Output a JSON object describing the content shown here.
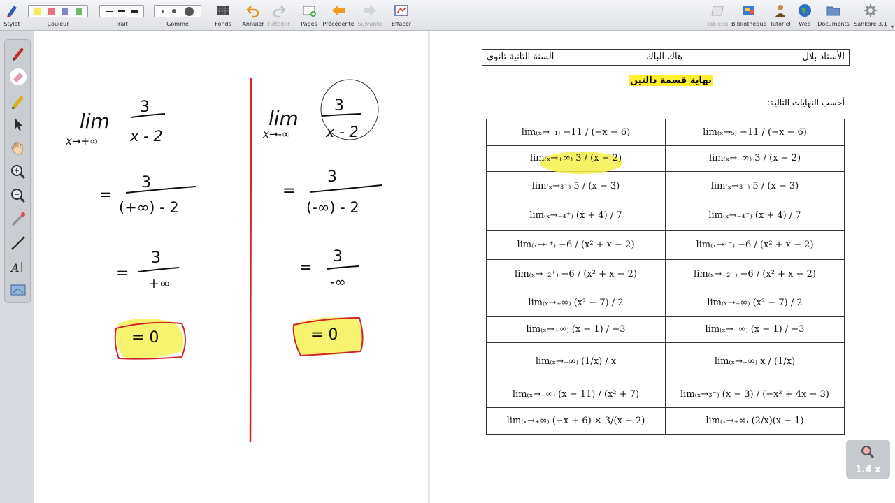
{
  "toolbar": {
    "pen": "Stylet",
    "color": "Couleur",
    "stroke": "Trait",
    "eraser": "Gomme",
    "background": "Fonds",
    "undo": "Annuler",
    "redo": "Rétablir",
    "pages": "Pages",
    "previous": "Précédente",
    "next": "Suivante",
    "clear": "Effacer",
    "board": "Tableau",
    "library": "Bibliothèque",
    "tutorial": "Tutoriel",
    "web": "Web",
    "documents": "Documents",
    "app": "Sankore 3.1"
  },
  "palette_icons": [
    "pen-icon",
    "eraser-icon",
    "marker-icon",
    "pointer-icon",
    "hand-icon",
    "zoom-in-icon",
    "zoom-out-icon",
    "laser-pointer-icon",
    "line-icon",
    "text-icon",
    "capture-icon"
  ],
  "colors": {
    "swatches": [
      "#f2ef55",
      "#e8717a",
      "#7d86c7",
      "#71b86b"
    ],
    "ink": "#111111",
    "red_line": "#d0252b",
    "highlight": "#f4f04a"
  },
  "left_page": {
    "col1": {
      "line1": {
        "lim": "lim",
        "sub": "x→+∞",
        "num": "3",
        "den": "x - 2"
      },
      "line2": {
        "eq": "=",
        "num": "3",
        "den": "(+∞) - 2"
      },
      "line3": {
        "eq": "=",
        "num": "3",
        "den": "+∞"
      },
      "result": "= 0"
    },
    "col2": {
      "line1": {
        "lim": "lim",
        "sub": "x→-∞",
        "num": "3",
        "den": "x - 2"
      },
      "line2": {
        "eq": "=",
        "num": "3",
        "den": "(-∞) - 2"
      },
      "line3": {
        "eq": "=",
        "num": "3",
        "den": "-∞"
      },
      "result": "= 0"
    }
  },
  "document": {
    "header": {
      "teacher": "الأستاذ بلال",
      "subject": "هاك الباك",
      "level": "السنة الثانية ثانوي"
    },
    "title": "نهاية قسمة دالتين",
    "instruction": "أحسب النهايات التالية:",
    "rows": [
      [
        "lim₍ₓ→₅₎ −11 / (−x − 6)",
        "lim₍ₓ→₋₁₎ −11 / (−x − 6)"
      ],
      [
        "lim₍ₓ→₋∞₎ 3 / (x − 2)",
        "lim₍ₓ→₊∞₎ 3 / (x − 2)"
      ],
      [
        "lim₍ₓ→₃⁻₎ 5 / (x − 3)",
        "lim₍ₓ→₃⁺₎ 5 / (x − 3)"
      ],
      [
        "lim₍ₓ→₋₄⁻₎ (x + 4) / 7",
        "lim₍ₓ→₋₄⁺₎ (x + 4) / 7"
      ],
      [
        "lim₍ₓ→₁⁻₎ −6 / (x² + x − 2)",
        "lim₍ₓ→₁⁺₎ −6 / (x² + x − 2)"
      ],
      [
        "lim₍ₓ→₋₂⁻₎ −6 / (x² + x − 2)",
        "lim₍ₓ→₋₂⁺₎ −6 / (x² + x − 2)"
      ],
      [
        "lim₍ₓ→₋∞₎ (x² − 7) / 2",
        "lim₍ₓ→₊∞₎ (x² − 7) / 2"
      ],
      [
        "lim₍ₓ→₋∞₎ (x − 1) / −3",
        "lim₍ₓ→₊∞₎ (x − 1) / −3"
      ],
      [
        "lim₍ₓ→₊∞₎ x / (1/x)",
        "lim₍ₓ→₋∞₎ (1/x) / x"
      ],
      [
        "lim₍ₓ→₃⁻₎ (x − 3) / (−x² + 4x − 3)",
        "lim₍ₓ→₊∞₎ (x − 11) / (x² + 7)"
      ],
      [
        "lim₍ₓ→₊∞₎ (2/x)(x − 1)",
        "lim₍ₓ→₊∞₎ (−x + 6) × 3/(x + 2)"
      ]
    ]
  },
  "zoom": {
    "level": "1.4 x"
  }
}
